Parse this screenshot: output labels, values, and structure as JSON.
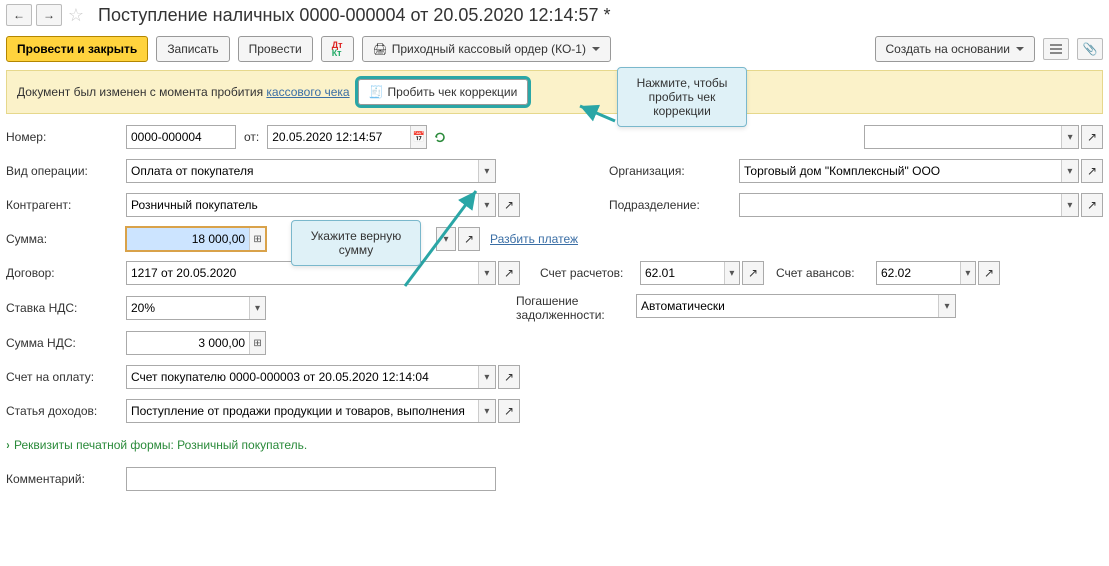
{
  "title": "Поступление наличных 0000-000004 от 20.05.2020 12:14:57 *",
  "toolbar": {
    "post_close": "Провести и закрыть",
    "write": "Записать",
    "post": "Провести",
    "print_ko1": "Приходный кассовый ордер (КО-1)",
    "create_based": "Создать на основании"
  },
  "notice": {
    "text_before": "Документ был изменен с момента пробития ",
    "link": "кассового чека",
    "correction_btn": "Пробить чек коррекции"
  },
  "callouts": {
    "correction_hint": "Нажмите, чтобы пробить чек коррекции",
    "sum_hint": "Укажите верную сумму"
  },
  "labels": {
    "number": "Номер:",
    "from": "от:",
    "op_type": "Вид операции:",
    "counterparty": "Контрагент:",
    "sum": "Сумма:",
    "split_payment": "Разбить платеж",
    "contract": "Договор:",
    "settlement_acc": "Счет расчетов:",
    "advance_acc": "Счет авансов:",
    "vat_rate": "Ставка НДС:",
    "debt_repay": "Погашение задолженности:",
    "vat_sum": "Сумма НДС:",
    "invoice": "Счет на оплату:",
    "income_item": "Статья доходов:",
    "print_props": "Реквизиты печатной формы: Розничный покупатель.",
    "comment": "Комментарий:",
    "organization": "Организация:",
    "department": "Подразделение:"
  },
  "values": {
    "number": "0000-000004",
    "date": "20.05.2020 12:14:57",
    "op_type": "Оплата от покупателя",
    "counterparty": "Розничный покупатель",
    "sum": "18 000,00",
    "contract": "1217 от 20.05.2020",
    "settlement_acc": "62.01",
    "advance_acc": "62.02",
    "vat_rate": "20%",
    "debt_repay": "Автоматически",
    "vat_sum": "3 000,00",
    "invoice": "Счет покупателю 0000-000003 от 20.05.2020 12:14:04",
    "income_item": "Поступление от продажи продукции и товаров, выполнения",
    "comment": "",
    "organization": "Торговый дом \"Комплексный\" ООО",
    "department": ""
  }
}
